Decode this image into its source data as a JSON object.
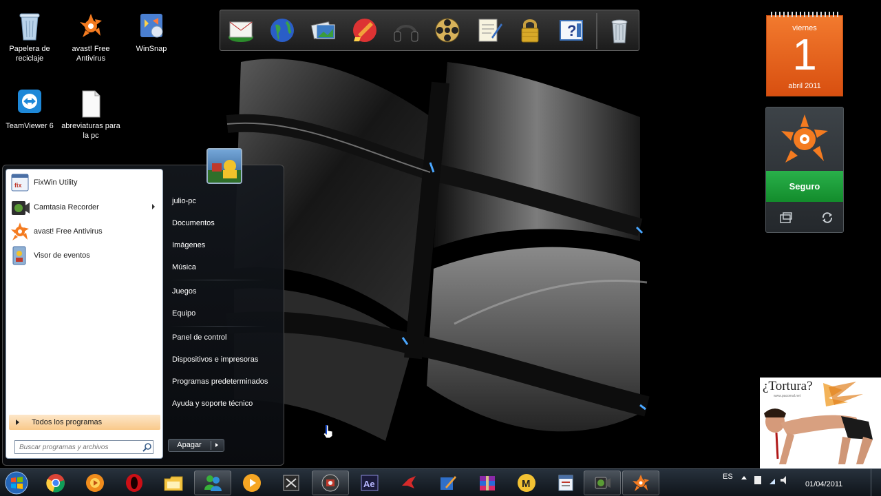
{
  "desktop": {
    "icons": [
      {
        "label": "Papelera de reciclaje",
        "icon": "recycle-bin-icon"
      },
      {
        "label": "avast! Free Antivirus",
        "icon": "avast-icon"
      },
      {
        "label": "WinSnap",
        "icon": "winsnap-icon"
      },
      {
        "label": "TeamViewer 6",
        "icon": "teamviewer-icon"
      },
      {
        "label": "abreviaturas para la pc",
        "icon": "text-file-icon"
      }
    ]
  },
  "dock": {
    "items": [
      "mail-icon",
      "globe-icon",
      "photos-icon",
      "ccleaner-icon",
      "headphones-icon",
      "film-reel-icon",
      "notepad-icon",
      "padlock-icon",
      "help-icon",
      "trash-icon"
    ]
  },
  "calendar": {
    "weekday": "viernes",
    "day": "1",
    "month_year": "abril 2011"
  },
  "avast_gadget": {
    "status": "Seguro",
    "colors": {
      "status": "#1ea13b",
      "brand": "#f47b20"
    }
  },
  "ad": {
    "title": "¿Tortura?",
    "subtitle": "www.pacomal.net"
  },
  "start_menu": {
    "pinned": [
      {
        "label": "FixWin Utility",
        "icon": "fixwin-icon",
        "has_submenu": false
      },
      {
        "label": "Camtasia Recorder",
        "icon": "camtasia-icon",
        "has_submenu": true
      },
      {
        "label": "avast! Free Antivirus",
        "icon": "avast-icon",
        "has_submenu": false
      },
      {
        "label": "Visor de eventos",
        "icon": "event-viewer-icon",
        "has_submenu": false
      }
    ],
    "all_programs": "Todos los programas",
    "search_placeholder": "Buscar programas y archivos",
    "right_items": {
      "user": "julio-pc",
      "documents": "Documentos",
      "pictures": "Imágenes",
      "music": "Música",
      "games": "Juegos",
      "computer": "Equipo",
      "control_panel": "Panel de control",
      "devices": "Dispositivos e impresoras",
      "default_programs": "Programas predeterminados",
      "help": "Ayuda y soporte técnico"
    },
    "shutdown": "Apagar"
  },
  "taskbar": {
    "items": [
      "windows-start-icon",
      "chrome-icon",
      "media-player-icon",
      "opera-icon",
      "file-explorer-icon",
      "messenger-icon",
      "play-icon",
      "game-icon",
      "webcam-icon",
      "after-effects-icon",
      "bird-icon",
      "paint-icon",
      "winrar-icon",
      "megaupload-icon",
      "fixwin-icon",
      "camtasia-icon",
      "avast-icon"
    ],
    "after_effects_label": "Ae",
    "megaupload_label": "M",
    "language": "ES",
    "date": "01/04/2011"
  }
}
